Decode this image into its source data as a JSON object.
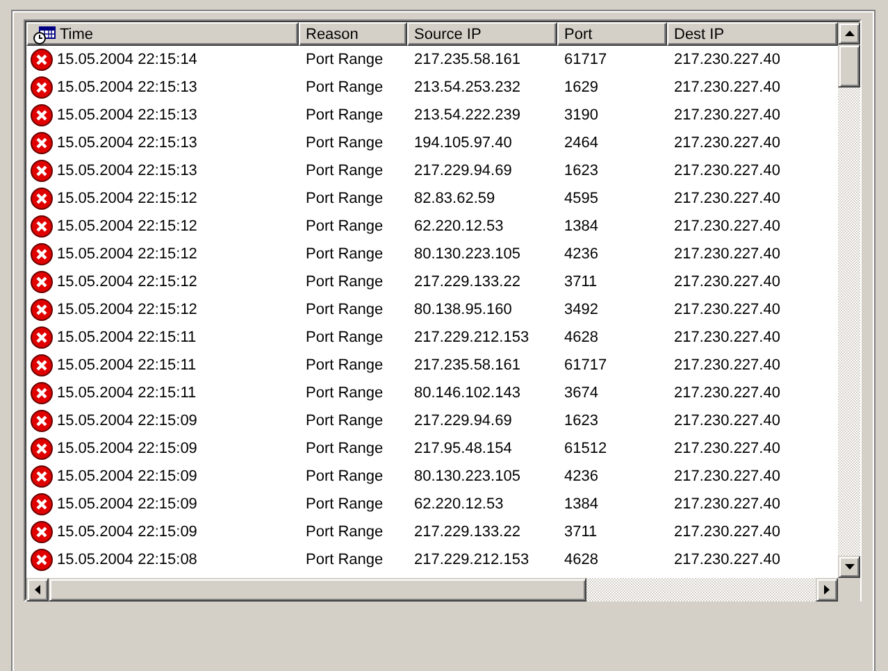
{
  "table": {
    "columns": [
      "Time",
      "Reason",
      "Source IP",
      "Port",
      "Dest IP"
    ],
    "rows": [
      [
        "15.05.2004 22:15:14",
        "Port Range",
        "217.235.58.161",
        "61717",
        "217.230.227.40"
      ],
      [
        "15.05.2004 22:15:13",
        "Port Range",
        "213.54.253.232",
        "1629",
        "217.230.227.40"
      ],
      [
        "15.05.2004 22:15:13",
        "Port Range",
        "213.54.222.239",
        "3190",
        "217.230.227.40"
      ],
      [
        "15.05.2004 22:15:13",
        "Port Range",
        "194.105.97.40",
        "2464",
        "217.230.227.40"
      ],
      [
        "15.05.2004 22:15:13",
        "Port Range",
        "217.229.94.69",
        "1623",
        "217.230.227.40"
      ],
      [
        "15.05.2004 22:15:12",
        "Port Range",
        "82.83.62.59",
        "4595",
        "217.230.227.40"
      ],
      [
        "15.05.2004 22:15:12",
        "Port Range",
        "62.220.12.53",
        "1384",
        "217.230.227.40"
      ],
      [
        "15.05.2004 22:15:12",
        "Port Range",
        "80.130.223.105",
        "4236",
        "217.230.227.40"
      ],
      [
        "15.05.2004 22:15:12",
        "Port Range",
        "217.229.133.22",
        "3711",
        "217.230.227.40"
      ],
      [
        "15.05.2004 22:15:12",
        "Port Range",
        "80.138.95.160",
        "3492",
        "217.230.227.40"
      ],
      [
        "15.05.2004 22:15:11",
        "Port Range",
        "217.229.212.153",
        "4628",
        "217.230.227.40"
      ],
      [
        "15.05.2004 22:15:11",
        "Port Range",
        "217.235.58.161",
        "61717",
        "217.230.227.40"
      ],
      [
        "15.05.2004 22:15:11",
        "Port Range",
        "80.146.102.143",
        "3674",
        "217.230.227.40"
      ],
      [
        "15.05.2004 22:15:09",
        "Port Range",
        "217.229.94.69",
        "1623",
        "217.230.227.40"
      ],
      [
        "15.05.2004 22:15:09",
        "Port Range",
        "217.95.48.154",
        "61512",
        "217.230.227.40"
      ],
      [
        "15.05.2004 22:15:09",
        "Port Range",
        "80.130.223.105",
        "4236",
        "217.230.227.40"
      ],
      [
        "15.05.2004 22:15:09",
        "Port Range",
        "62.220.12.53",
        "1384",
        "217.230.227.40"
      ],
      [
        "15.05.2004 22:15:09",
        "Port Range",
        "217.229.133.22",
        "3711",
        "217.230.227.40"
      ],
      [
        "15.05.2004 22:15:08",
        "Port Range",
        "217.229.212.153",
        "4628",
        "217.230.227.40"
      ]
    ]
  }
}
